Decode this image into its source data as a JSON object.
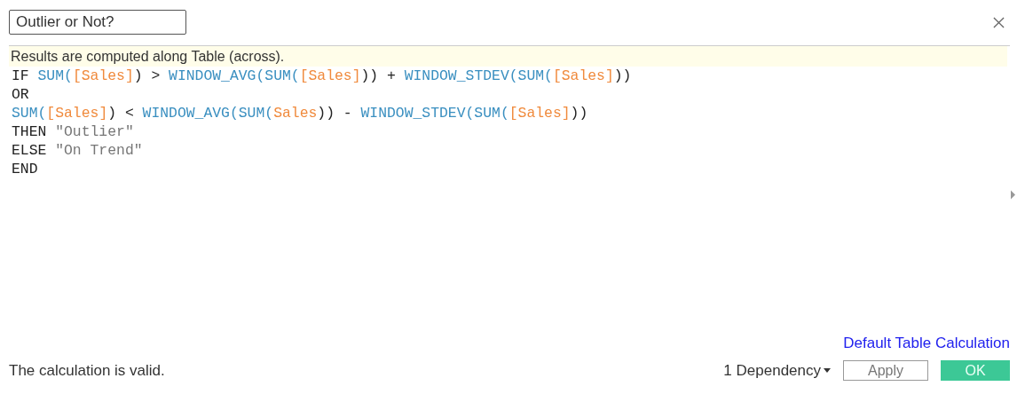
{
  "name_field": {
    "value": "Outlier or Not?"
  },
  "info_banner": "Results are computed along Table (across).",
  "formula_lines": [
    [
      {
        "text": "IF ",
        "kind": "keyword"
      },
      {
        "text": "SUM(",
        "kind": "function"
      },
      {
        "text": "[Sales]",
        "kind": "field"
      },
      {
        "text": ") > ",
        "kind": "operator"
      },
      {
        "text": "WINDOW_AVG(SUM(",
        "kind": "function"
      },
      {
        "text": "[Sales]",
        "kind": "field"
      },
      {
        "text": ")) + ",
        "kind": "operator"
      },
      {
        "text": "WINDOW_STDEV(SUM(",
        "kind": "function"
      },
      {
        "text": "[Sales]",
        "kind": "field"
      },
      {
        "text": "))",
        "kind": "operator"
      }
    ],
    [
      {
        "text": "OR",
        "kind": "keyword"
      }
    ],
    [
      {
        "text": "SUM(",
        "kind": "function"
      },
      {
        "text": "[Sales]",
        "kind": "field"
      },
      {
        "text": ") < ",
        "kind": "operator"
      },
      {
        "text": "WINDOW_AVG(SUM(",
        "kind": "function"
      },
      {
        "text": "Sales",
        "kind": "field"
      },
      {
        "text": ")) - ",
        "kind": "operator"
      },
      {
        "text": "WINDOW_STDEV(SUM(",
        "kind": "function"
      },
      {
        "text": "[Sales]",
        "kind": "field"
      },
      {
        "text": "))",
        "kind": "operator"
      }
    ],
    [
      {
        "text": "THEN ",
        "kind": "keyword"
      },
      {
        "text": "\"Outlier\"",
        "kind": "string"
      }
    ],
    [
      {
        "text": "ELSE ",
        "kind": "keyword"
      },
      {
        "text": "\"On Trend\"",
        "kind": "string"
      }
    ],
    [
      {
        "text": "END",
        "kind": "keyword"
      }
    ]
  ],
  "default_table_calculation_link": "Default Table Calculation",
  "status": "The calculation is valid.",
  "dependency_menu": "1 Dependency",
  "buttons": [
    {
      "label": "Apply",
      "kind": "secondary"
    },
    {
      "label": "OK",
      "kind": "primary"
    }
  ]
}
